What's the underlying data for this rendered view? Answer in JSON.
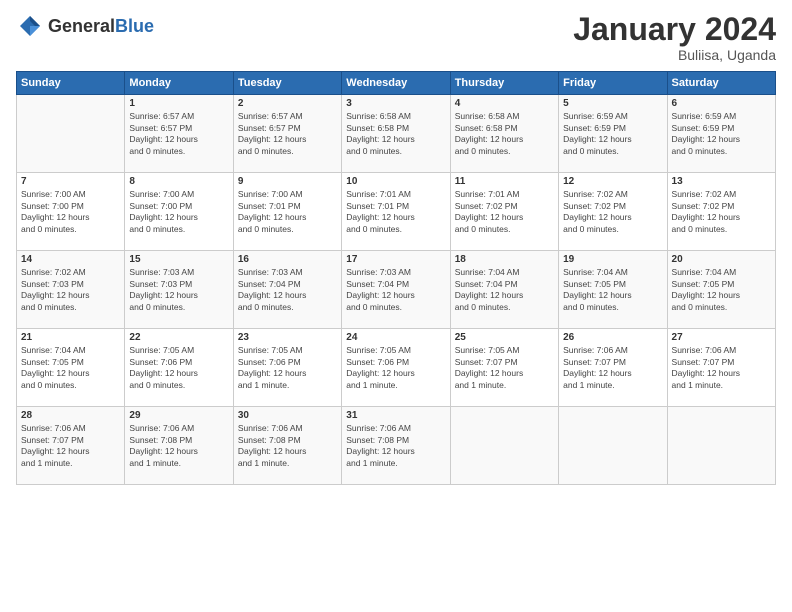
{
  "header": {
    "logo_general": "General",
    "logo_blue": "Blue",
    "title": "January 2024",
    "location": "Buliisa, Uganda"
  },
  "weekdays": [
    "Sunday",
    "Monday",
    "Tuesday",
    "Wednesday",
    "Thursday",
    "Friday",
    "Saturday"
  ],
  "weeks": [
    [
      {
        "day": "",
        "info": ""
      },
      {
        "day": "1",
        "info": "Sunrise: 6:57 AM\nSunset: 6:57 PM\nDaylight: 12 hours\nand 0 minutes."
      },
      {
        "day": "2",
        "info": "Sunrise: 6:57 AM\nSunset: 6:57 PM\nDaylight: 12 hours\nand 0 minutes."
      },
      {
        "day": "3",
        "info": "Sunrise: 6:58 AM\nSunset: 6:58 PM\nDaylight: 12 hours\nand 0 minutes."
      },
      {
        "day": "4",
        "info": "Sunrise: 6:58 AM\nSunset: 6:58 PM\nDaylight: 12 hours\nand 0 minutes."
      },
      {
        "day": "5",
        "info": "Sunrise: 6:59 AM\nSunset: 6:59 PM\nDaylight: 12 hours\nand 0 minutes."
      },
      {
        "day": "6",
        "info": "Sunrise: 6:59 AM\nSunset: 6:59 PM\nDaylight: 12 hours\nand 0 minutes."
      }
    ],
    [
      {
        "day": "7",
        "info": "Sunrise: 7:00 AM\nSunset: 7:00 PM\nDaylight: 12 hours\nand 0 minutes."
      },
      {
        "day": "8",
        "info": "Sunrise: 7:00 AM\nSunset: 7:00 PM\nDaylight: 12 hours\nand 0 minutes."
      },
      {
        "day": "9",
        "info": "Sunrise: 7:00 AM\nSunset: 7:01 PM\nDaylight: 12 hours\nand 0 minutes."
      },
      {
        "day": "10",
        "info": "Sunrise: 7:01 AM\nSunset: 7:01 PM\nDaylight: 12 hours\nand 0 minutes."
      },
      {
        "day": "11",
        "info": "Sunrise: 7:01 AM\nSunset: 7:02 PM\nDaylight: 12 hours\nand 0 minutes."
      },
      {
        "day": "12",
        "info": "Sunrise: 7:02 AM\nSunset: 7:02 PM\nDaylight: 12 hours\nand 0 minutes."
      },
      {
        "day": "13",
        "info": "Sunrise: 7:02 AM\nSunset: 7:02 PM\nDaylight: 12 hours\nand 0 minutes."
      }
    ],
    [
      {
        "day": "14",
        "info": "Sunrise: 7:02 AM\nSunset: 7:03 PM\nDaylight: 12 hours\nand 0 minutes."
      },
      {
        "day": "15",
        "info": "Sunrise: 7:03 AM\nSunset: 7:03 PM\nDaylight: 12 hours\nand 0 minutes."
      },
      {
        "day": "16",
        "info": "Sunrise: 7:03 AM\nSunset: 7:04 PM\nDaylight: 12 hours\nand 0 minutes."
      },
      {
        "day": "17",
        "info": "Sunrise: 7:03 AM\nSunset: 7:04 PM\nDaylight: 12 hours\nand 0 minutes."
      },
      {
        "day": "18",
        "info": "Sunrise: 7:04 AM\nSunset: 7:04 PM\nDaylight: 12 hours\nand 0 minutes."
      },
      {
        "day": "19",
        "info": "Sunrise: 7:04 AM\nSunset: 7:05 PM\nDaylight: 12 hours\nand 0 minutes."
      },
      {
        "day": "20",
        "info": "Sunrise: 7:04 AM\nSunset: 7:05 PM\nDaylight: 12 hours\nand 0 minutes."
      }
    ],
    [
      {
        "day": "21",
        "info": "Sunrise: 7:04 AM\nSunset: 7:05 PM\nDaylight: 12 hours\nand 0 minutes."
      },
      {
        "day": "22",
        "info": "Sunrise: 7:05 AM\nSunset: 7:06 PM\nDaylight: 12 hours\nand 0 minutes."
      },
      {
        "day": "23",
        "info": "Sunrise: 7:05 AM\nSunset: 7:06 PM\nDaylight: 12 hours\nand 1 minute."
      },
      {
        "day": "24",
        "info": "Sunrise: 7:05 AM\nSunset: 7:06 PM\nDaylight: 12 hours\nand 1 minute."
      },
      {
        "day": "25",
        "info": "Sunrise: 7:05 AM\nSunset: 7:07 PM\nDaylight: 12 hours\nand 1 minute."
      },
      {
        "day": "26",
        "info": "Sunrise: 7:06 AM\nSunset: 7:07 PM\nDaylight: 12 hours\nand 1 minute."
      },
      {
        "day": "27",
        "info": "Sunrise: 7:06 AM\nSunset: 7:07 PM\nDaylight: 12 hours\nand 1 minute."
      }
    ],
    [
      {
        "day": "28",
        "info": "Sunrise: 7:06 AM\nSunset: 7:07 PM\nDaylight: 12 hours\nand 1 minute."
      },
      {
        "day": "29",
        "info": "Sunrise: 7:06 AM\nSunset: 7:08 PM\nDaylight: 12 hours\nand 1 minute."
      },
      {
        "day": "30",
        "info": "Sunrise: 7:06 AM\nSunset: 7:08 PM\nDaylight: 12 hours\nand 1 minute."
      },
      {
        "day": "31",
        "info": "Sunrise: 7:06 AM\nSunset: 7:08 PM\nDaylight: 12 hours\nand 1 minute."
      },
      {
        "day": "",
        "info": ""
      },
      {
        "day": "",
        "info": ""
      },
      {
        "day": "",
        "info": ""
      }
    ]
  ]
}
